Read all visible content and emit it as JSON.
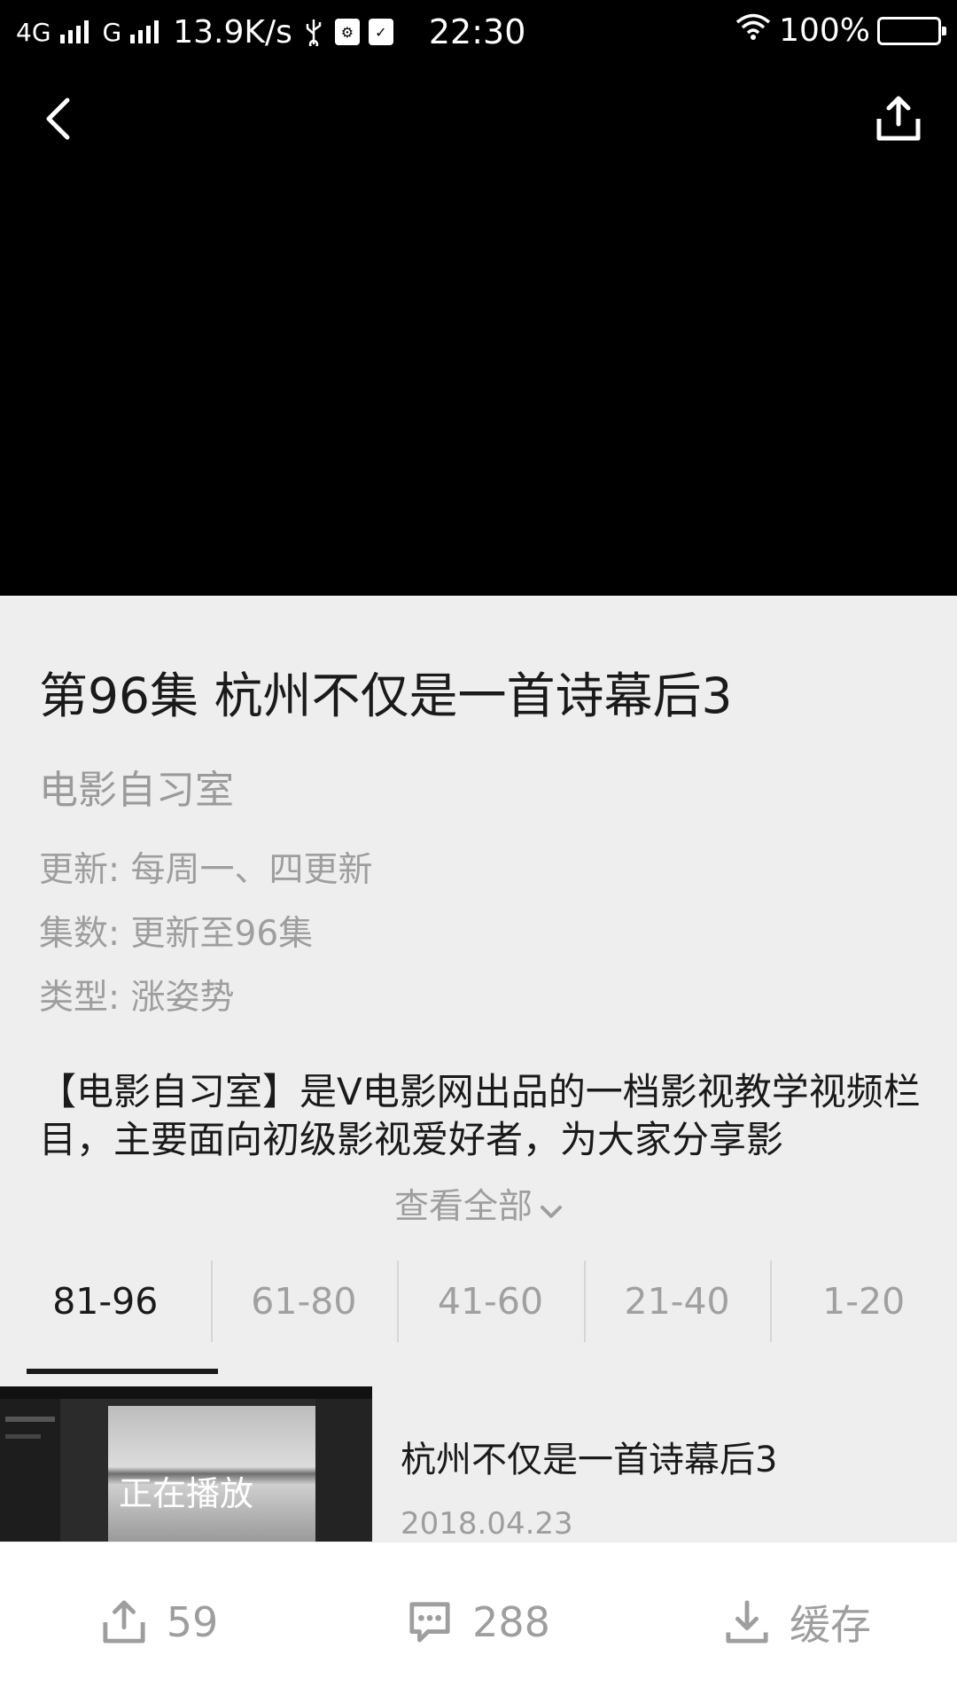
{
  "status_bar": {
    "network1": "4G",
    "network2": "G",
    "speed": "13.9K/s",
    "time": "22:30",
    "battery": "100%"
  },
  "header": {
    "back_icon": "chevron-left-icon",
    "share_icon": "share-icon"
  },
  "video": {
    "title": "第96集 杭州不仅是一首诗幕后3",
    "channel": "电影自习室",
    "update": "更新: 每周一、四更新",
    "episodes": "集数: 更新至96集",
    "genre": "类型: 涨姿势",
    "description": "【电影自习室】是V电影网出品的一档影视教学视频栏目，主要面向初级影视爱好者，为大家分享影",
    "view_all": "查看全部"
  },
  "tabs": [
    {
      "label": "81-96",
      "active": true
    },
    {
      "label": "61-80",
      "active": false
    },
    {
      "label": "41-60",
      "active": false
    },
    {
      "label": "21-40",
      "active": false
    },
    {
      "label": "1-20",
      "active": false
    }
  ],
  "episodes": [
    {
      "title": "杭州不仅是一首诗幕后3",
      "date": "2018.04.23",
      "status": "正在播放"
    }
  ],
  "bottom_bar": {
    "share_count": "59",
    "comment_count": "288",
    "download_label": "缓存"
  },
  "colors": {
    "background": "#eeeeee",
    "video_bg": "#000000",
    "text_primary": "#1a1a1a",
    "text_secondary": "#9e9e9e"
  }
}
